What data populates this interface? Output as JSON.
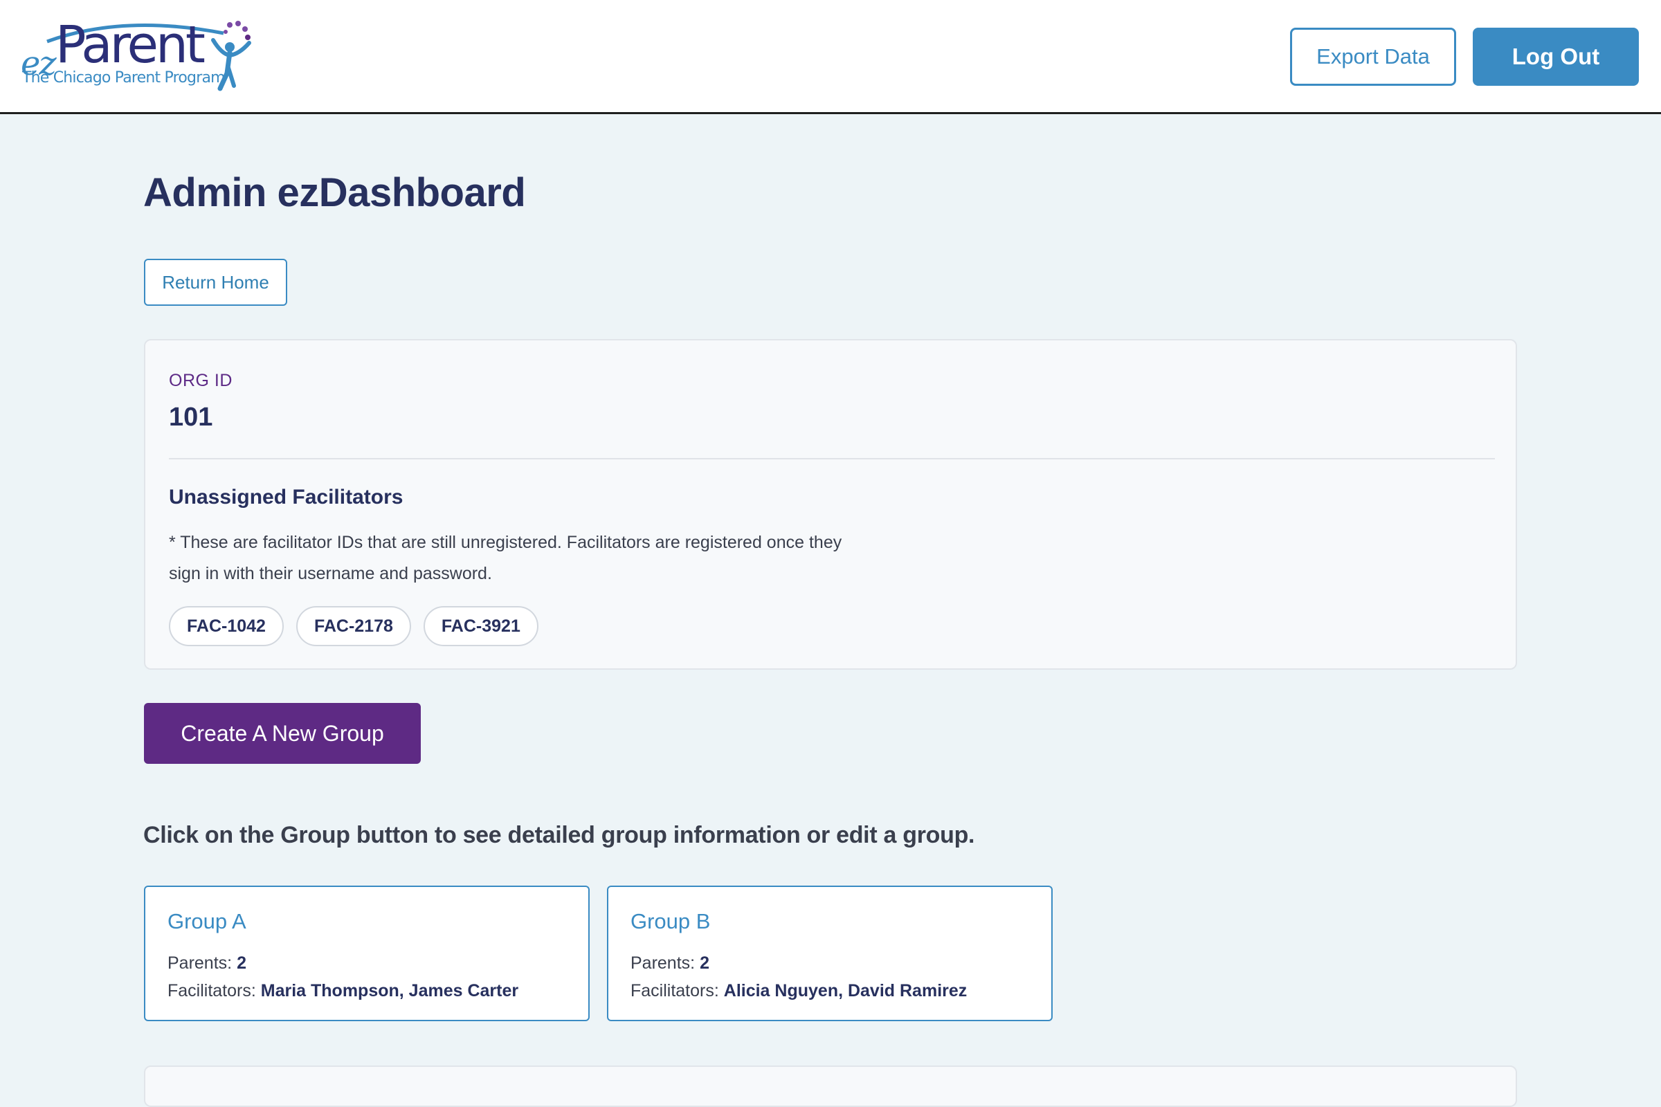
{
  "header": {
    "logo": {
      "ez": "ez",
      "parent": "Parent",
      "subtitle": "The Chicago Parent Program"
    },
    "export_label": "Export Data",
    "logout_label": "Log Out"
  },
  "page": {
    "title": "Admin ezDashboard",
    "return_label": "Return Home"
  },
  "org": {
    "label": "ORG ID",
    "id": "101",
    "unassigned_title": "Unassigned Facilitators",
    "note": "* These are facilitator IDs that are still unregistered. Facilitators are registered once they sign in with their username and password.",
    "facilitator_ids": [
      "FAC-1042",
      "FAC-2178",
      "FAC-3921"
    ]
  },
  "create_group_label": "Create A New Group",
  "instruction": "Click on the Group button to see detailed group information or edit a group.",
  "groups": [
    {
      "name": "Group A",
      "parents_label": "Parents:",
      "parents_count": "2",
      "facilitators_label": "Facilitators:",
      "facilitators": "Maria Thompson, James Carter"
    },
    {
      "name": "Group B",
      "parents_label": "Parents:",
      "parents_count": "2",
      "facilitators_label": "Facilitators:",
      "facilitators": "Alicia Nguyen, David Ramirez"
    }
  ],
  "colors": {
    "brand_blue": "#3a8bc3",
    "navy": "#27305e",
    "purple": "#5e2a84",
    "background": "#edf4f7"
  },
  "icons": [
    "logo-figure-icon",
    "logo-swoosh-icon"
  ]
}
